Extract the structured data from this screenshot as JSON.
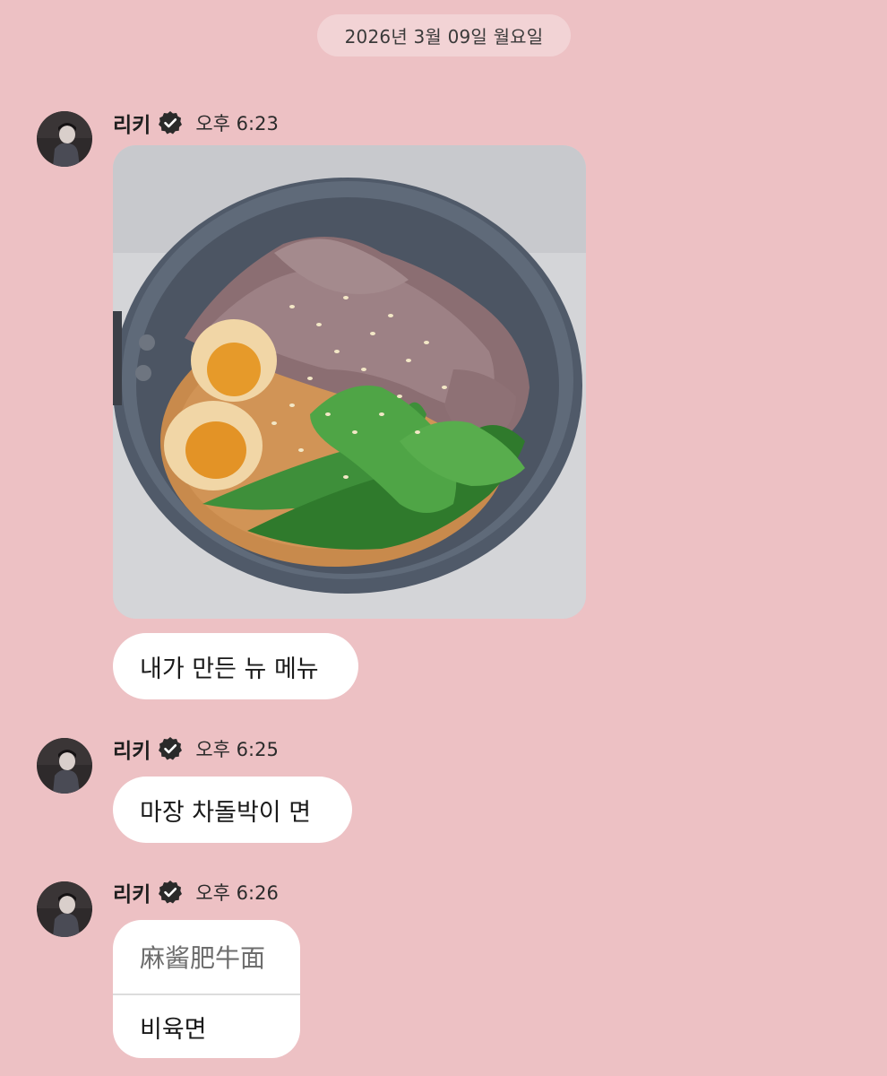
{
  "date_divider": "2026년 3월 09일 월요일",
  "colors": {
    "background": "#EDC1C4",
    "date_pill": "#F2D3D5",
    "bubble": "#FFFFFF",
    "verified_badge": "#2A2A2A"
  },
  "messages": [
    {
      "sender": "리키",
      "verified_icon": "verified-badge-icon",
      "time": "오후 6:23",
      "image": "photo-of-noodle-bowl-with-beef-egg-bok-choy",
      "text": "내가 만든 뉴 메뉴"
    },
    {
      "sender": "리키",
      "verified_icon": "verified-badge-icon",
      "time": "오후 6:25",
      "text": "마장 차돌박이 면"
    },
    {
      "sender": "리키",
      "verified_icon": "verified-badge-icon",
      "time": "오후 6:26",
      "quoted_text": "麻酱肥牛面",
      "text": "비육면"
    }
  ]
}
